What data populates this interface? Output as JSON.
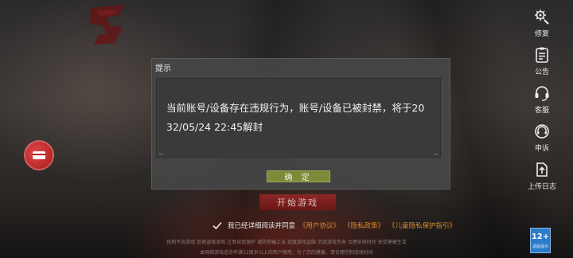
{
  "right_menu": [
    {
      "name": "repair",
      "label": "修复",
      "icon": "wrench-gear-icon"
    },
    {
      "name": "notice",
      "label": "公告",
      "icon": "clipboard-icon"
    },
    {
      "name": "support",
      "label": "客服",
      "icon": "headset-icon"
    },
    {
      "name": "appeal",
      "label": "申诉",
      "icon": "chat-headset-icon"
    },
    {
      "name": "upload-log",
      "label": "上传日志",
      "icon": "upload-icon"
    }
  ],
  "dialog": {
    "title": "提示",
    "message": "当前账号/设备存在违规行为，账号/设备已被封禁，将于2032/05/24 22:45解封",
    "ok_label": "确 定"
  },
  "start_button": "开始游戏",
  "agreement": {
    "prefix": "我已经详细阅读并同意",
    "link_user": "《用户协议》",
    "link_privacy": "《隐私政策》",
    "link_child": "《儿童隐私保护指引》"
  },
  "footer": {
    "line1": "抵制不良游戏 拒绝盗版游戏 注意自我保护 谨防受骗上当 适度游戏益脑 沉迷游戏伤身 合理安排时间 享受健康生活",
    "line2": "本网络游戏适合年满12周岁以上的用户使用，为了您的健康，请合理控制游戏时间"
  },
  "age_rating": {
    "number": "12+",
    "label": "适龄提示"
  },
  "colors": {
    "accent_link": "#d8882a",
    "ok_button": "#7d8a3a",
    "dialog_bg": "#464646"
  }
}
